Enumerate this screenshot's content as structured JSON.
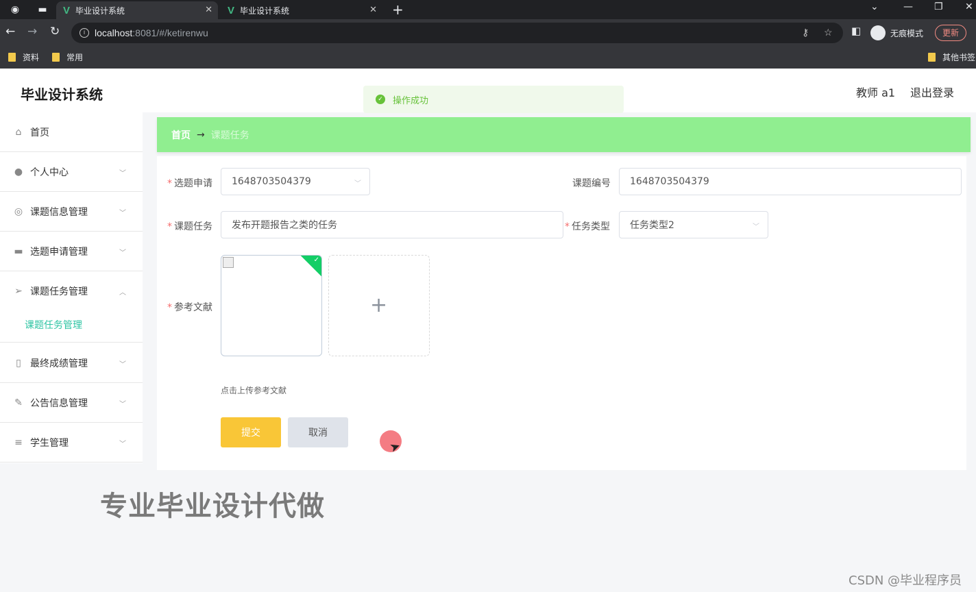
{
  "browser": {
    "tabs": [
      {
        "title": "毕业设计系统",
        "active": true
      },
      {
        "title": "毕业设计系统",
        "active": false
      }
    ],
    "url_host": "localhost",
    "url_rest": ":8081/#/ketirenwu",
    "incognito_label": "无痕模式",
    "update_label": "更新",
    "bookmarks": [
      "资料",
      "常用"
    ],
    "other_bookmarks": "其他书签"
  },
  "header": {
    "title": "毕业设计系统",
    "user": "教师 a1",
    "logout": "退出登录"
  },
  "toast": {
    "message": "操作成功",
    "color": "#67c23a"
  },
  "sidebar": {
    "items": [
      {
        "label": "首页",
        "icon": "home-icon"
      },
      {
        "label": "个人中心",
        "icon": "user-icon"
      },
      {
        "label": "课题信息管理",
        "icon": "circle-icon"
      },
      {
        "label": "选题申请管理",
        "icon": "monitor-icon"
      },
      {
        "label": "课题任务管理",
        "icon": "send-icon"
      },
      {
        "label": "最终成绩管理",
        "icon": "mic-icon"
      },
      {
        "label": "公告信息管理",
        "icon": "pen-icon"
      },
      {
        "label": "学生管理",
        "icon": "list-icon"
      }
    ],
    "submenu": {
      "label": "课题任务管理"
    },
    "accent": "#2ec4a3"
  },
  "breadcrumb": {
    "home": "首页",
    "separator": "→",
    "current": "课题任务",
    "bg": "#90ee90"
  },
  "form": {
    "xuanti_label": "选题申请",
    "xuanti_value": "1648703504379",
    "keti_no_label": "课题编号",
    "keti_no_value": "1648703504379",
    "renwu_label": "课题任务",
    "renwu_value": "发布开题报告之类的任务",
    "type_label": "任务类型",
    "type_value": "任务类型2",
    "ref_label": "参考文献",
    "upload_tip": "点击上传参考文献",
    "submit": "提交",
    "cancel": "取消"
  },
  "watermark": {
    "big": "专业毕业设计代做",
    "small": "CSDN @毕业程序员"
  }
}
